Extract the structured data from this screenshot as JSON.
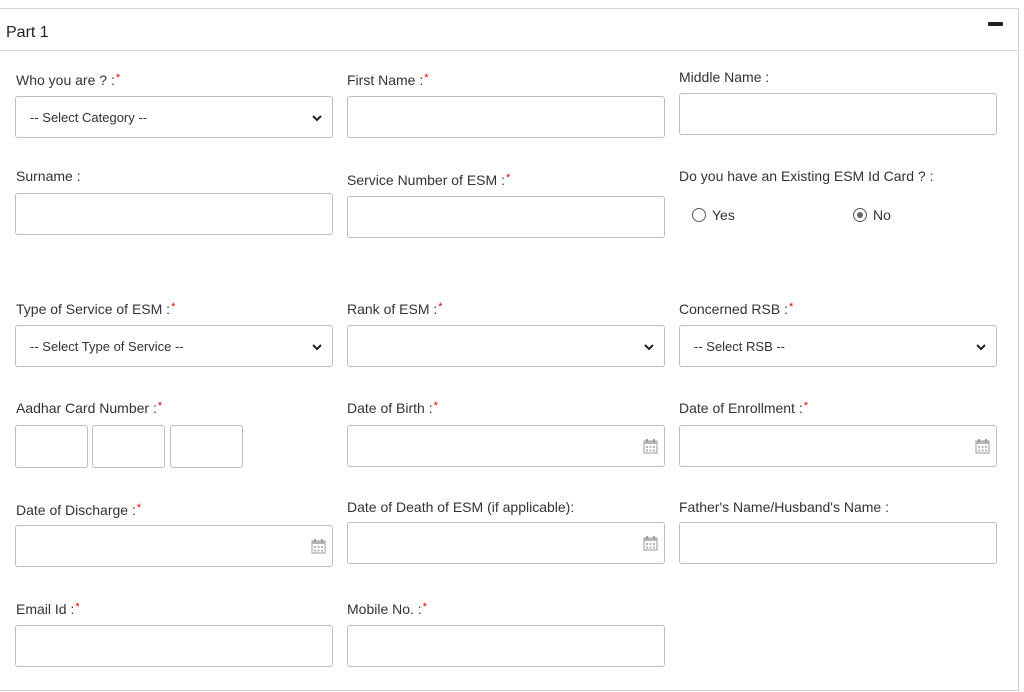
{
  "panel": {
    "title": "Part 1"
  },
  "fields": {
    "category": {
      "label": "Who you are ? :",
      "value": "-- Select Category --"
    },
    "first_name": {
      "label": "First Name :"
    },
    "middle_name": {
      "label": "Middle Name :"
    },
    "surname": {
      "label": "Surname :"
    },
    "service_number": {
      "label": "Service Number of ESM :"
    },
    "existing_card": {
      "label": "Do you have an Existing ESM Id Card ? :",
      "options": [
        "Yes",
        "No"
      ],
      "selected": "No"
    },
    "service_type": {
      "label": "Type of Service of ESM :",
      "value": "-- Select Type of Service --"
    },
    "rank": {
      "label": "Rank of ESM :",
      "value": ""
    },
    "rsb": {
      "label": "Concerned RSB :",
      "value": "-- Select RSB --"
    },
    "aadhar": {
      "label": "Aadhar Card Number :"
    },
    "dob": {
      "label": "Date of Birth :"
    },
    "enrollment": {
      "label": "Date of Enrollment :"
    },
    "discharge": {
      "label": "Date of Discharge :"
    },
    "death": {
      "label": "Date of Death of ESM (if applicable):"
    },
    "father": {
      "label": "Father's Name/Husband's Name :"
    },
    "email": {
      "label": "Email Id :"
    },
    "mobile": {
      "label": "Mobile No. :"
    }
  },
  "required_marker": "*",
  "colors": {
    "required": "#e60000",
    "border": "#bdbdbd"
  }
}
